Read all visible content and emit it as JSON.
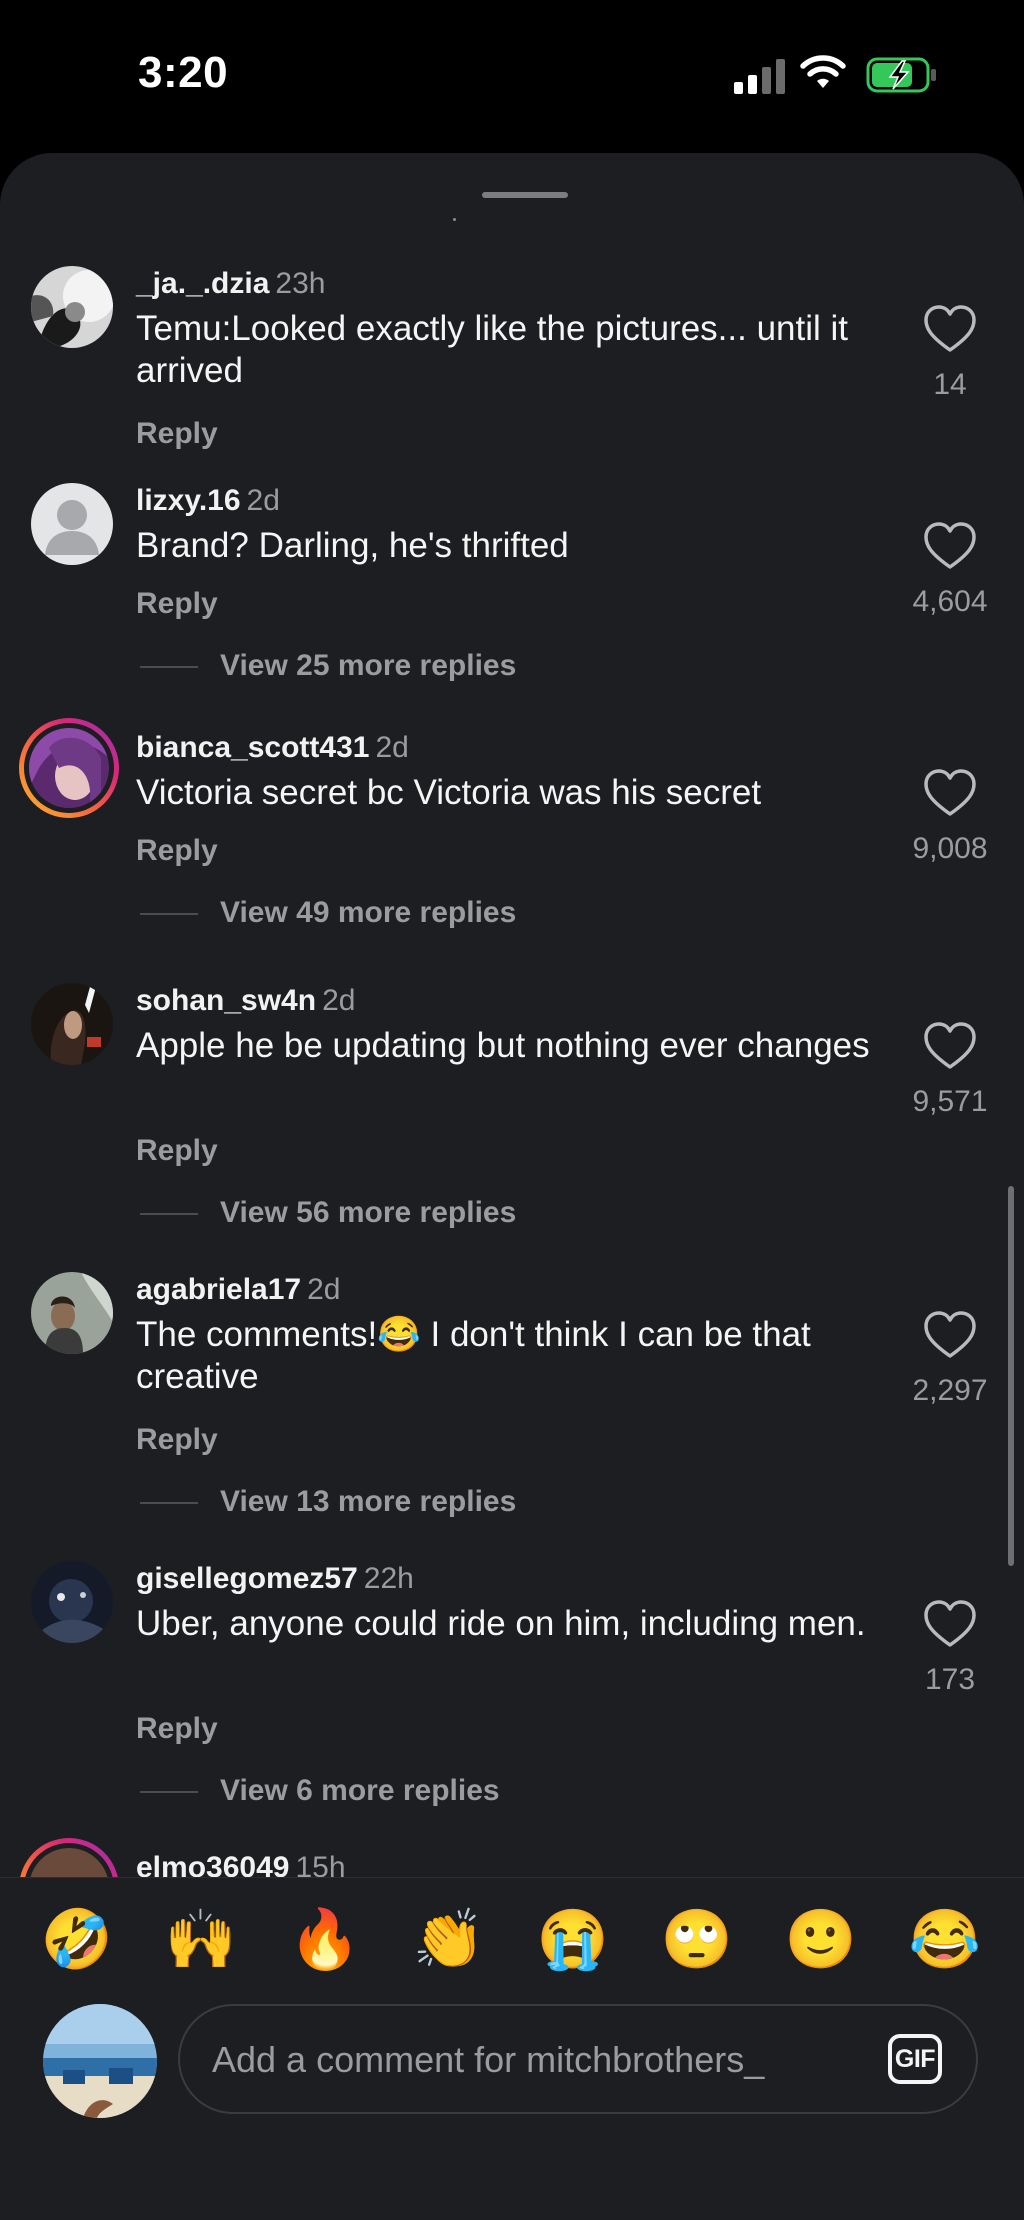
{
  "status_bar": {
    "time": "3:20"
  },
  "comments": [
    {
      "username": "_ja._.dzia",
      "age": "23h",
      "text": "Temu:Looked exactly like the pictures... until it arrived",
      "reply_label": "Reply",
      "likes": "14",
      "view_more": ""
    },
    {
      "username": "lizxy.16",
      "age": "2d",
      "text": "Brand? Darling, he's thrifted",
      "reply_label": "Reply",
      "likes": "4,604",
      "view_more": "View 25 more replies"
    },
    {
      "username": "bianca_scott431",
      "age": "2d",
      "text": "Victoria secret bc Victoria was his secret",
      "reply_label": "Reply",
      "likes": "9,008",
      "view_more": "View 49 more replies"
    },
    {
      "username": "sohan_sw4n",
      "age": "2d",
      "text": "Apple he be updating but nothing ever changes",
      "reply_label": "Reply",
      "likes": "9,571",
      "view_more": "View 56 more replies"
    },
    {
      "username": "agabriela17",
      "age": "2d",
      "text": "The comments!😂 I don't think I can be that creative",
      "reply_label": "Reply",
      "likes": "2,297",
      "view_more": "View 13 more replies"
    },
    {
      "username": "gisellegomez57",
      "age": "22h",
      "text": "Uber, anyone could ride on him, including men.",
      "reply_label": "Reply",
      "likes": "173",
      "view_more": "View 6 more replies"
    },
    {
      "username": "elmo36049",
      "age": "15h"
    }
  ],
  "emoji_bar": [
    "🤣",
    "🙌",
    "🔥",
    "👏",
    "😭",
    "🙄",
    "🙂",
    "😂"
  ],
  "composer": {
    "placeholder": "Add a comment for mitchbrothers_",
    "gif_label": "GIF"
  }
}
